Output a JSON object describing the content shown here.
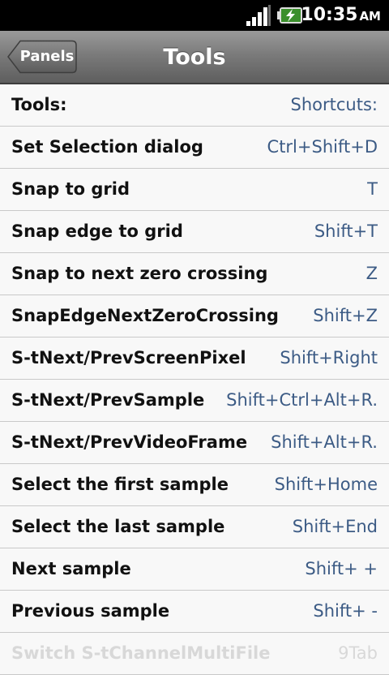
{
  "status": {
    "time": "10:35",
    "ampm": "AM"
  },
  "header": {
    "back_label": "Panels",
    "title": "Tools"
  },
  "rows": [
    {
      "name": "Tools:",
      "key": "Shortcuts:"
    },
    {
      "name": "Set Selection dialog",
      "key": "Ctrl+Shift+D"
    },
    {
      "name": "Snap to grid",
      "key": "T"
    },
    {
      "name": "Snap edge to grid",
      "key": "Shift+T"
    },
    {
      "name": "Snap to next zero crossing",
      "key": "Z"
    },
    {
      "name": "SnapEdgeNextZeroCrossing",
      "key": "Shift+Z"
    },
    {
      "name": "S-tNext/PrevScreenPixel",
      "key": "Shift+Right"
    },
    {
      "name": "S-tNext/PrevSample",
      "key": "Shift+Ctrl+Alt+R."
    },
    {
      "name": "S-tNext/PrevVideoFrame",
      "key": "Shift+Alt+R."
    },
    {
      "name": "Select the first sample",
      "key": "Shift+Home"
    },
    {
      "name": "Select the last sample",
      "key": "Shift+End"
    },
    {
      "name": "Next sample",
      "key": "Shift+ +"
    },
    {
      "name": "Previous sample",
      "key": "Shift+ -"
    },
    {
      "name": "Switch S-tChannelMultiFile",
      "key": "9Tab"
    }
  ],
  "colors": {
    "accent": "#3c5b85",
    "statusbar": "#000000",
    "titlebar": "#7b7b7b"
  },
  "icons": {
    "signal": "signal-icon",
    "battery": "battery-charging-icon",
    "back": "back-arrow-icon"
  }
}
